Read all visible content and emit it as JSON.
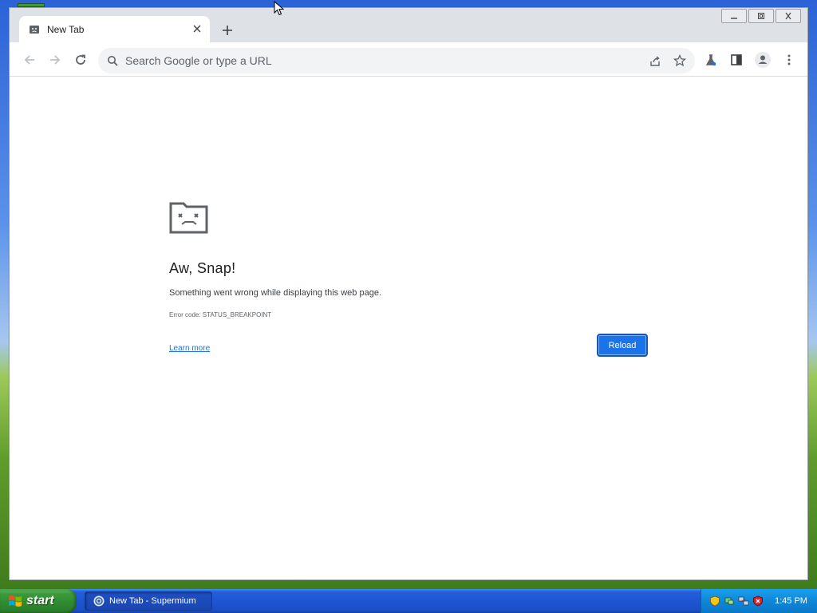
{
  "browser": {
    "tab": {
      "title": "New Tab"
    },
    "omnibox": {
      "placeholder": "Search Google or type a URL"
    }
  },
  "error_page": {
    "title": "Aw, Snap!",
    "description": "Something went wrong while displaying this web page.",
    "error_code": "Error code: STATUS_BREAKPOINT",
    "learn_more": "Learn more",
    "reload": "Reload"
  },
  "taskbar": {
    "start_label": "start",
    "task_item_label": "New Tab - Supermium",
    "clock": "1:45 PM"
  },
  "colors": {
    "accent": "#1a73e8",
    "taskbar": "#245edb",
    "start_button": "#3c9a3c",
    "tray": "#0f87d8"
  },
  "icons": {
    "tab_favicon": "sad-page-icon",
    "tab_close": "close-icon",
    "new_tab": "plus-icon",
    "back": "arrow-left-icon",
    "forward": "arrow-right-icon",
    "reload": "reload-icon",
    "search": "search-icon",
    "share": "share-icon",
    "bookmark": "star-icon",
    "labs": "flask-icon",
    "side_panel": "side-panel-icon",
    "profile": "person-icon",
    "menu": "kebab-menu-icon"
  }
}
